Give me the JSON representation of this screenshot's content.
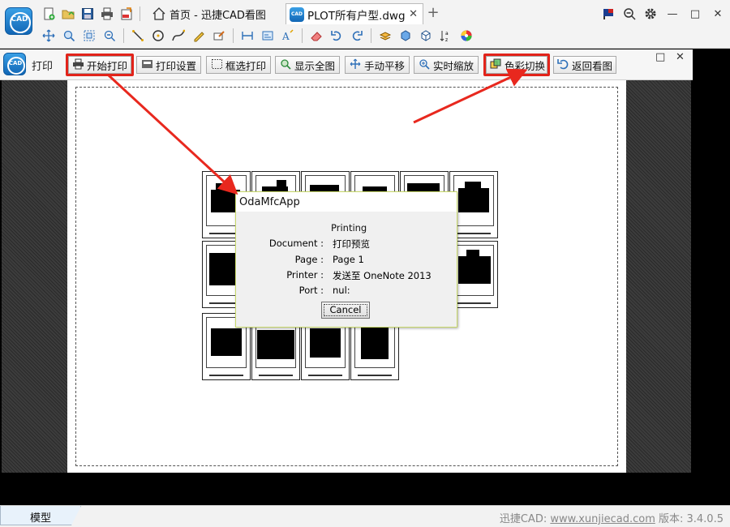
{
  "app": {
    "logo_text": "CAD"
  },
  "tabs": {
    "home_label": "首页 - 迅捷CAD看图",
    "file_label": "PLOT所有户型.dwg",
    "file_close": "✕",
    "add": "+"
  },
  "print_panel": {
    "logo_text": "CAD",
    "title": "打印",
    "buttons": [
      {
        "label": "开始打印",
        "icon": "printer-icon"
      },
      {
        "label": "打印设置",
        "icon": "print-settings-icon"
      },
      {
        "label": "框选打印",
        "icon": "box-select-icon"
      },
      {
        "label": "显示全图",
        "icon": "zoom-extents-icon"
      },
      {
        "label": "手动平移",
        "icon": "pan-icon"
      },
      {
        "label": "实时缩放",
        "icon": "realtime-zoom-icon"
      },
      {
        "label": "色彩切换",
        "icon": "color-switch-icon"
      },
      {
        "label": "返回看图",
        "icon": "return-icon"
      }
    ],
    "restore": "□",
    "close": "✕"
  },
  "dialog": {
    "title": "OdaMfcApp",
    "status": "Printing",
    "document_label": "Document :",
    "document_value": "打印预览",
    "page_label": "Page :",
    "page_value": "Page 1",
    "printer_label": "Printer :",
    "printer_value": "发送至 OneNote 2013",
    "port_label": "Port :",
    "port_value": "nul:",
    "cancel_label": "Cancel"
  },
  "statusbar": {
    "model_tab": "模型",
    "brand": "迅捷CAD: ",
    "site": "www.xunjiecad.com",
    "version": " 版本: 3.4.0.5"
  },
  "colors": {
    "highlight": "#e2231a",
    "accent_blue": "#1166b5",
    "dialog_border": "#c8d96a"
  }
}
